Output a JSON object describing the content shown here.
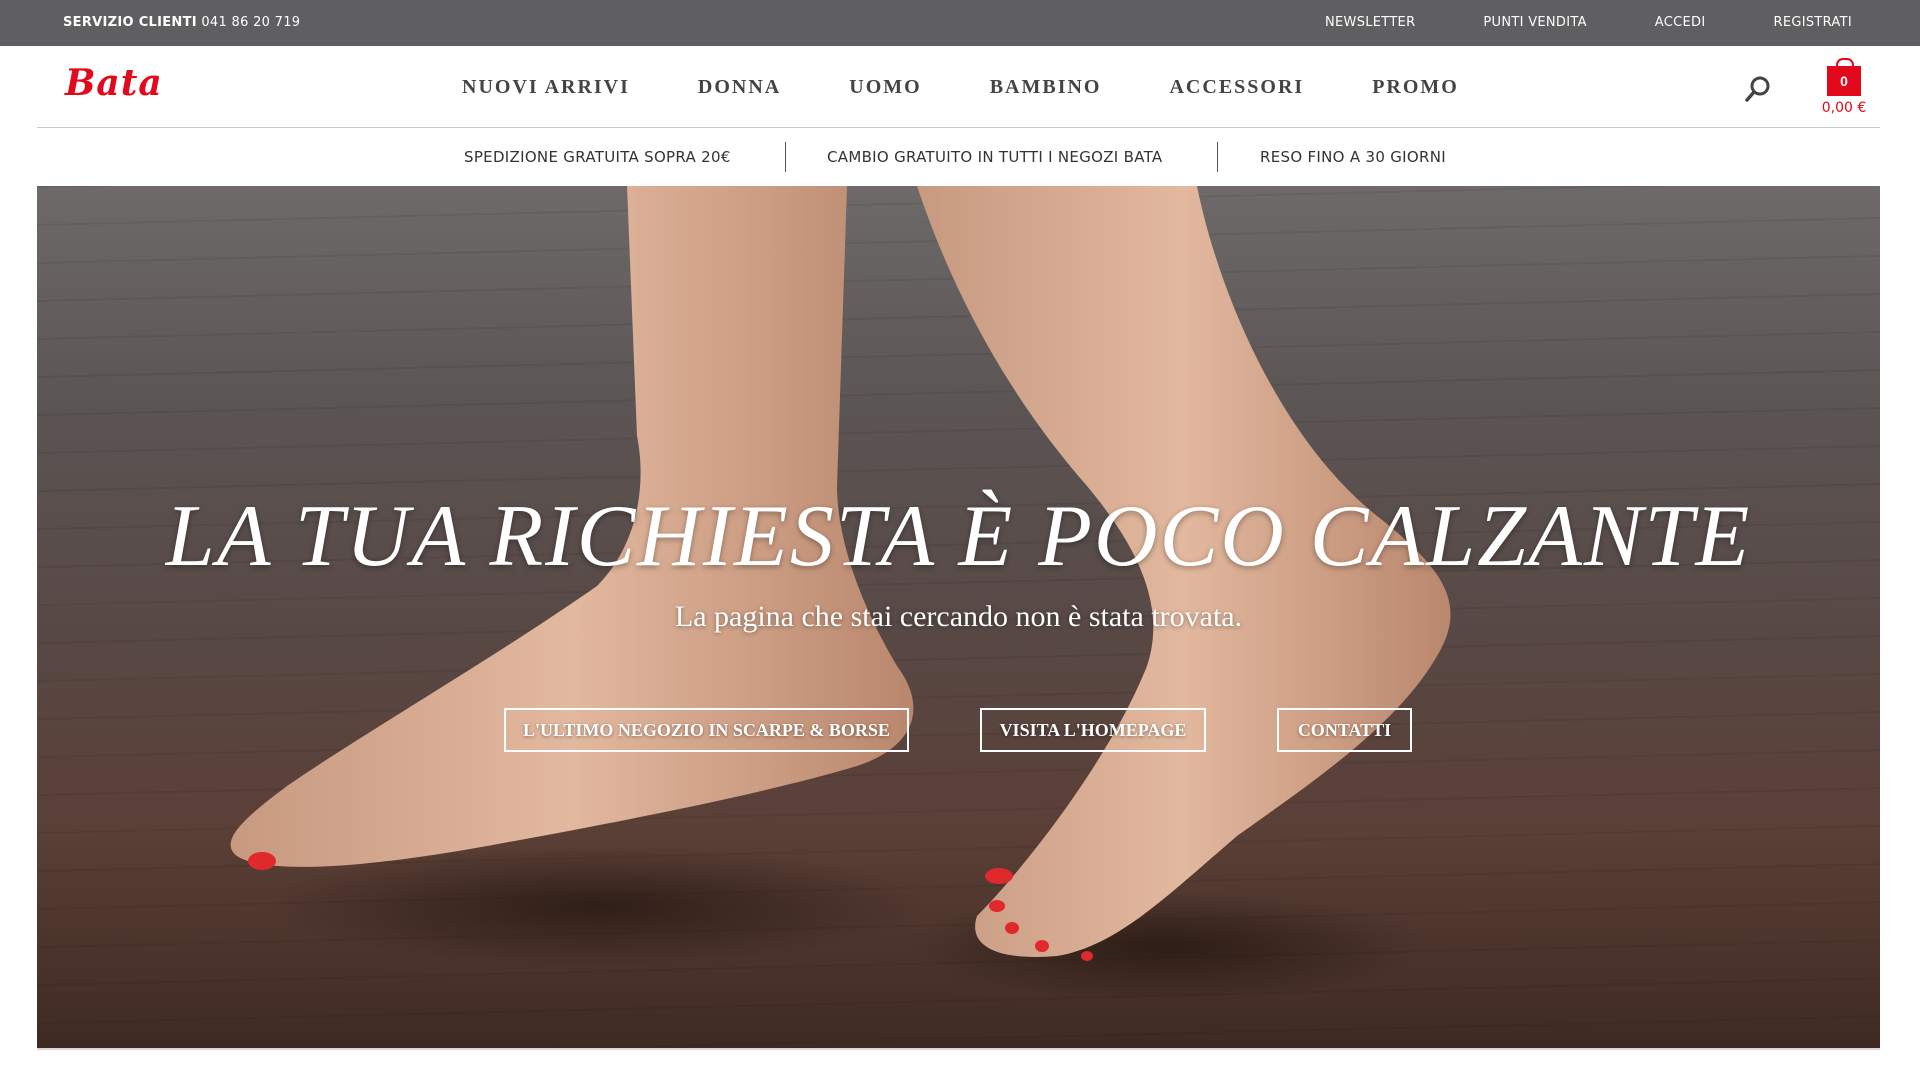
{
  "topbar": {
    "service_label": "SERVIZIO CLIENTI",
    "service_phone": "041 86 20 719",
    "links": [
      "NEWSLETTER",
      "PUNTI VENDITA",
      "ACCEDI",
      "REGISTRATI"
    ]
  },
  "header": {
    "logo": "Bata",
    "nav": [
      "NUOVI ARRIVI",
      "DONNA",
      "UOMO",
      "BAMBINO",
      "ACCESSORI",
      "PROMO"
    ],
    "search_icon": "search-icon",
    "cart": {
      "count": "0",
      "total": "0,00 €"
    }
  },
  "benefits": [
    "SPEDIZIONE GRATUITA SOPRA 20€",
    "CAMBIO GRATUITO IN TUTTI I NEGOZI BATA",
    "RESO FINO A 30 GIORNI"
  ],
  "hero": {
    "title": "LA TUA RICHIESTA È POCO CALZANTE",
    "subtitle": "La pagina che stai cercando non è stata trovata.",
    "buttons": [
      "L'ULTIMO NEGOZIO IN SCARPE & BORSE",
      "VISITA L'HOMEPAGE",
      "CONTATTI"
    ]
  },
  "colors": {
    "brand_red": "#e1091b",
    "topbar_bg": "#5f5f61"
  }
}
